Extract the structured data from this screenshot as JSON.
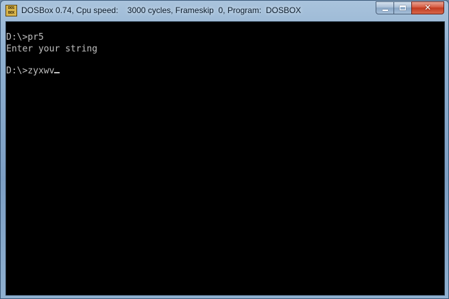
{
  "window": {
    "icon_label": "DOS BOX",
    "title": {
      "app": "DOSBox 0.74, Cpu speed:",
      "cycles": "3000 cycles, Frameskip  0, Program:",
      "program": "DOSBOX"
    },
    "controls": {
      "minimize_icon": "minimize-icon",
      "maximize_icon": "maximize-icon",
      "close_glyph": "✕"
    }
  },
  "terminal": {
    "foreground": "#c0c0c0",
    "background": "#000000",
    "lines": [
      "D:\\>pr5",
      "Enter your string",
      "D:\\>zyxwv"
    ]
  }
}
